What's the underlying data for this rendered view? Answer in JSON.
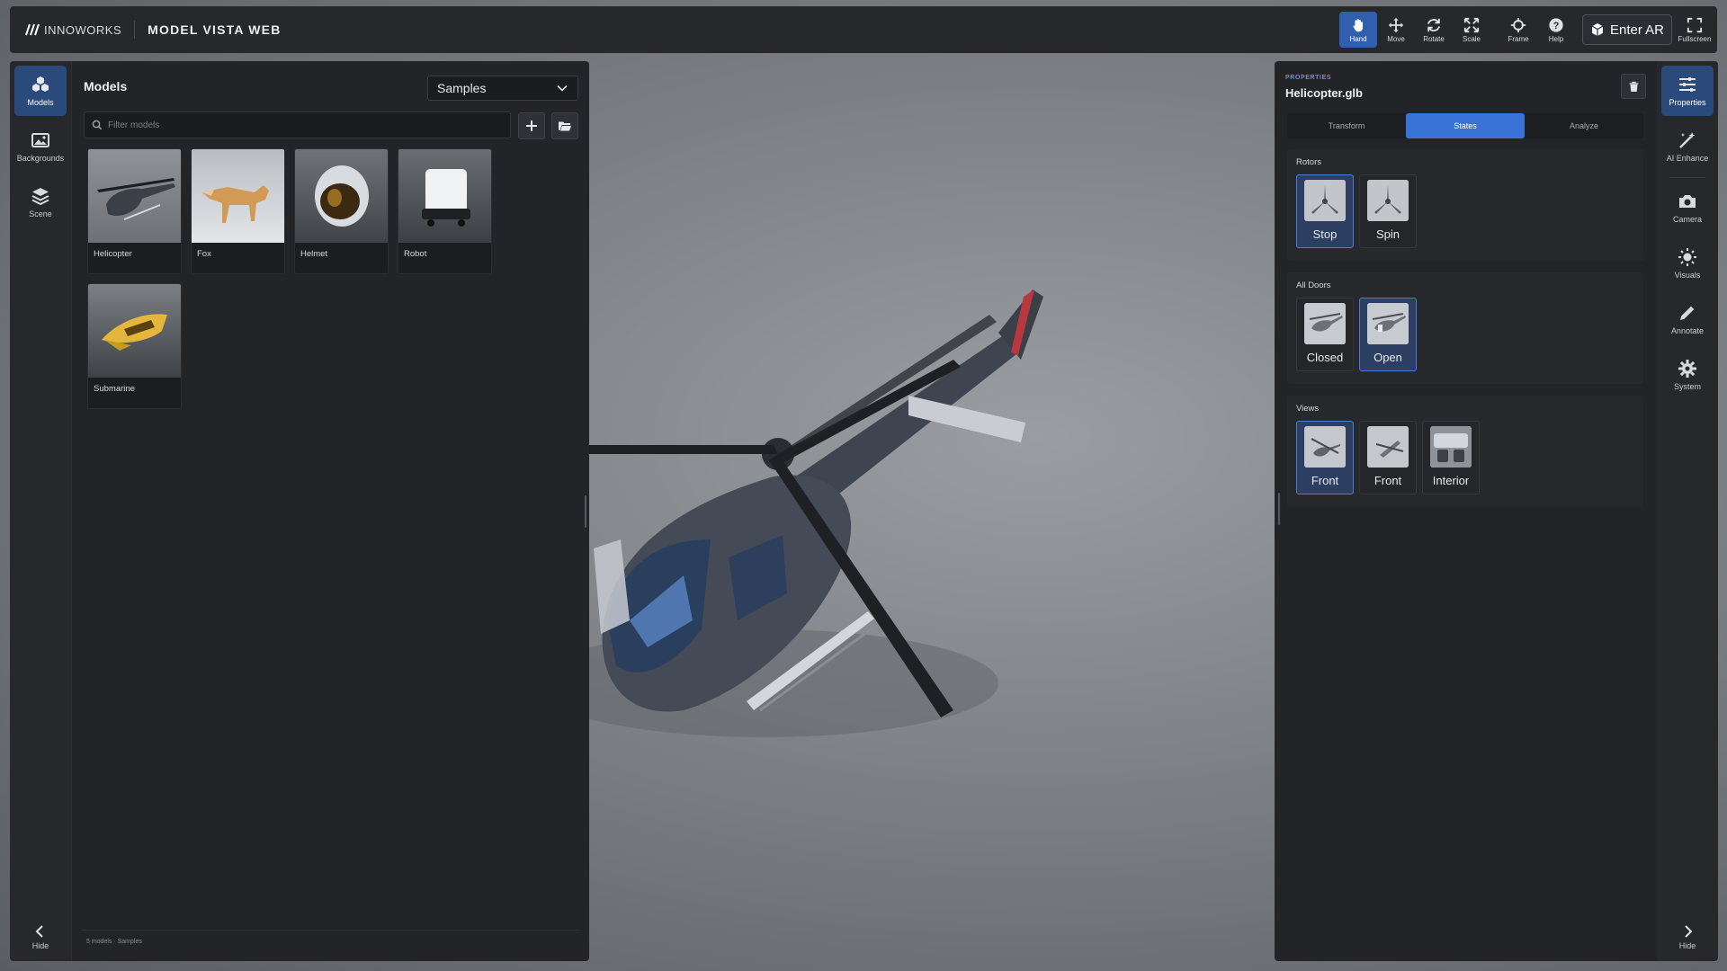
{
  "brand": {
    "name": "INNOWORKS",
    "app_title": "MODEL VISTA WEB"
  },
  "toolbar": {
    "tools": [
      {
        "label": "Hand",
        "icon": "hand-icon",
        "active": true
      },
      {
        "label": "Move",
        "icon": "move-icon"
      },
      {
        "label": "Rotate",
        "icon": "rotate-icon"
      },
      {
        "label": "Scale",
        "icon": "scale-icon"
      },
      {
        "label": "Frame",
        "icon": "frame-icon"
      },
      {
        "label": "Help",
        "icon": "help-icon"
      }
    ],
    "enter_ar": "Enter AR",
    "fullscreen": "Fullscreen"
  },
  "left_rail": {
    "items": [
      {
        "label": "Models",
        "icon": "models-icon",
        "active": true
      },
      {
        "label": "Backgrounds",
        "icon": "image-icon"
      },
      {
        "label": "Scene",
        "icon": "layers-icon"
      }
    ],
    "hide": "Hide"
  },
  "models_panel": {
    "title": "Models",
    "source_select": "Samples",
    "search_placeholder": "Filter models",
    "models": [
      {
        "name": "Helicopter"
      },
      {
        "name": "Fox"
      },
      {
        "name": "Helmet"
      },
      {
        "name": "Robot"
      },
      {
        "name": "Submarine"
      }
    ],
    "footer": "5 models · Samples"
  },
  "properties": {
    "kicker": "PROPERTIES",
    "title": "Helicopter.glb",
    "tabs": [
      {
        "label": "Transform"
      },
      {
        "label": "States",
        "active": true
      },
      {
        "label": "Analyze"
      }
    ],
    "groups": [
      {
        "title": "Rotors",
        "states": [
          {
            "label": "Stop",
            "active": true
          },
          {
            "label": "Spin"
          }
        ]
      },
      {
        "title": "All Doors",
        "states": [
          {
            "label": "Closed"
          },
          {
            "label": "Open",
            "active": true
          }
        ]
      },
      {
        "title": "Views",
        "states": [
          {
            "label": "Front",
            "active": true
          },
          {
            "label": "Front"
          },
          {
            "label": "Interior"
          }
        ]
      }
    ]
  },
  "right_rail": {
    "items": [
      {
        "label": "Properties",
        "icon": "sliders-icon",
        "active": true
      },
      {
        "label": "AI Enhance",
        "icon": "magic-wand-icon"
      },
      {
        "label": "Camera",
        "icon": "camera-icon"
      },
      {
        "label": "Visuals",
        "icon": "sun-icon"
      },
      {
        "label": "Annotate",
        "icon": "pencil-icon"
      },
      {
        "label": "System",
        "icon": "gear-icon"
      }
    ],
    "hide": "Hide"
  },
  "colors": {
    "accent": "#3a73d8",
    "panel": "#222428",
    "rail": "#26282c"
  }
}
